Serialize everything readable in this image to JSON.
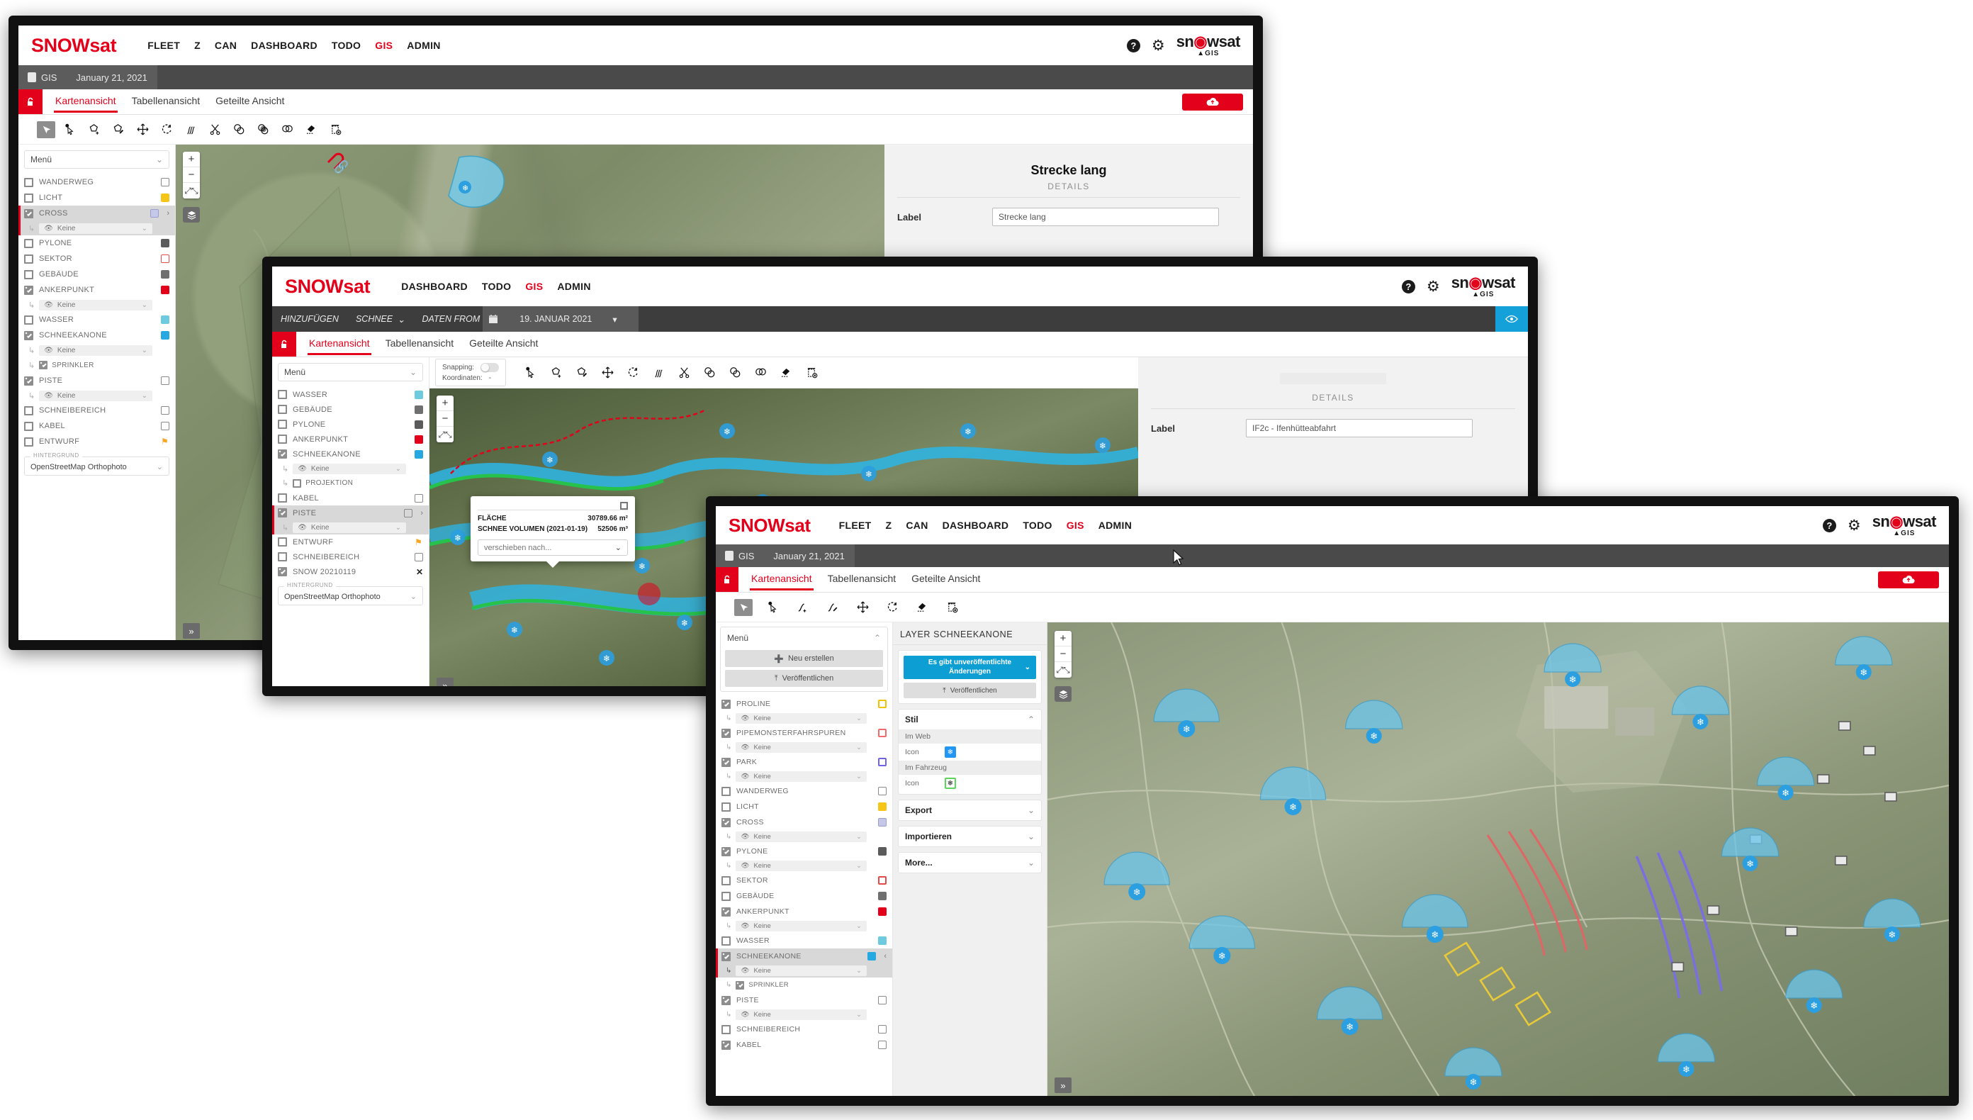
{
  "brand": "SNOWsat",
  "logo": {
    "line1_a": "sn",
    "line1_dot": "O",
    "line1_b": "wsat",
    "line2": "GIS"
  },
  "icons": {
    "help": "?",
    "gear": "gear-icon",
    "database": "database-icon",
    "cloud": "cloud-upload-icon",
    "lock": "lock-open-icon"
  },
  "window1": {
    "nav": [
      "FLEET",
      "Z",
      "CAN",
      "DASHBOARD",
      "TODO",
      "GIS",
      "ADMIN"
    ],
    "nav_active": "GIS",
    "context": {
      "app": "GIS",
      "date": "January 21, 2021"
    },
    "tabs": [
      "Kartenansicht",
      "Tabellenansicht",
      "Geteilte Ansicht"
    ],
    "tab_active": "Kartenansicht",
    "tools": [
      "select-pointer-icon",
      "info-select-icon",
      "draw-polygon-icon",
      "edit-polygon-icon",
      "move-icon",
      "rotate-icon",
      "split-line-icon",
      "scissors-icon",
      "union-icon",
      "intersect-icon",
      "difference-icon",
      "erase-icon",
      "delete-icon"
    ],
    "menu_label": "Menü",
    "layers": [
      {
        "name": "WANDERWEG",
        "checked": false,
        "selected": false,
        "swatch": "none",
        "sub": null
      },
      {
        "name": "LICHT",
        "checked": false,
        "selected": false,
        "swatch": "#f5c518",
        "sub": null
      },
      {
        "name": "CROSS",
        "checked": true,
        "selected": true,
        "swatch": "#c5c8e8",
        "chevron": "›",
        "sub": "Keine"
      },
      {
        "name": "PYLONE",
        "checked": false,
        "selected": false,
        "swatch": "#5b5b5b",
        "sub": null
      },
      {
        "name": "SEKTOR",
        "checked": false,
        "selected": false,
        "swatch": "#e34b4b",
        "sub": null
      },
      {
        "name": "GEBÄUDE",
        "checked": false,
        "selected": false,
        "swatch": "#6f6f6f",
        "sub": null
      },
      {
        "name": "ANKERPUNKT",
        "checked": true,
        "selected": false,
        "swatch": "#e3001b",
        "sub": "Keine"
      },
      {
        "name": "WASSER",
        "checked": false,
        "selected": false,
        "swatch": "#6ecadf",
        "sub": null
      },
      {
        "name": "SCHNEEKANONE",
        "checked": true,
        "selected": false,
        "swatch": "#26a9e0",
        "sub": "Keine"
      },
      {
        "name": "SPRINKLER",
        "checked": true,
        "selected": false,
        "swatch": "none",
        "indent": true,
        "sub": null
      },
      {
        "name": "PISTE",
        "checked": true,
        "selected": false,
        "swatch": "none",
        "sub": "Keine"
      },
      {
        "name": "SCHNEIBEREICH",
        "checked": false,
        "selected": false,
        "swatch": "none",
        "sub": null
      },
      {
        "name": "KABEL",
        "checked": false,
        "selected": false,
        "swatch": "none",
        "sub": null
      },
      {
        "name": "ENTWURF",
        "checked": false,
        "selected": false,
        "swatch": "#f5a623",
        "sub": null
      }
    ],
    "background": {
      "legend": "HINTERGRUND",
      "value": "OpenStreetMap Orthophoto"
    },
    "details": {
      "title": "Strecke lang",
      "subtitle": "DETAILS",
      "label_caption": "Label",
      "label_value": "Strecke lang"
    },
    "map": {
      "zoom_in": "+",
      "zoom_out": "−",
      "fit": "fit-icon",
      "layers": "layers-icon",
      "expand": "»"
    }
  },
  "window2": {
    "nav": [
      "DASHBOARD",
      "TODO",
      "GIS",
      "ADMIN"
    ],
    "nav_active": "GIS",
    "addbar": {
      "add": "HINZUFÜGEN",
      "type": "SCHNEE",
      "data_from": "DATEN FROM",
      "calendar": "calendar-icon",
      "date": "19. JANUAR 2021",
      "eye": "eye-icon"
    },
    "tabs": [
      "Kartenansicht",
      "Tabellenansicht",
      "Geteilte Ansicht"
    ],
    "tab_active": "Kartenansicht",
    "snapping": {
      "label": "Snapping:",
      "coords_label": "Koordinaten:",
      "coords_value": "-",
      "enabled": false
    },
    "tools": [
      "info-select-icon",
      "draw-polygon-icon",
      "edit-polygon-icon",
      "move-icon",
      "rotate-icon",
      "split-line-icon",
      "scissors-icon",
      "union-icon",
      "intersect-icon",
      "difference-icon",
      "erase-icon",
      "delete-icon"
    ],
    "menu_label": "Menü",
    "layers": [
      {
        "name": "WASSER",
        "checked": false,
        "selected": false,
        "swatch": "#6ecadf",
        "sub": null
      },
      {
        "name": "GEBÄUDE",
        "checked": false,
        "selected": false,
        "swatch": "#6f6f6f",
        "sub": null
      },
      {
        "name": "PYLONE",
        "checked": false,
        "selected": false,
        "swatch": "#5b5b5b",
        "sub": null
      },
      {
        "name": "ANKERPUNKT",
        "checked": false,
        "selected": false,
        "swatch": "#e3001b",
        "sub": null
      },
      {
        "name": "SCHNEEKANONE",
        "checked": true,
        "selected": false,
        "swatch": "#26a9e0",
        "sub": "Keine"
      },
      {
        "name": "PROJEKTION",
        "checked": false,
        "selected": false,
        "swatch": "none",
        "indent": true,
        "sub": null
      },
      {
        "name": "KABEL",
        "checked": false,
        "selected": false,
        "swatch": "none",
        "sub": null
      },
      {
        "name": "PISTE",
        "checked": true,
        "selected": true,
        "swatch": "none",
        "chevron": "›",
        "sub": "Keine"
      },
      {
        "name": "ENTWURF",
        "checked": false,
        "selected": false,
        "swatch": "#f5a623",
        "sub": null
      },
      {
        "name": "SCHNEIBEREICH",
        "checked": false,
        "selected": false,
        "swatch": "none",
        "sub": null
      },
      {
        "name": "SNOW 20210119",
        "checked": true,
        "selected": false,
        "swatch": "close",
        "sub": null
      }
    ],
    "background": {
      "legend": "HINTERGRUND",
      "value": "OpenStreetMap Orthophoto"
    },
    "popup": {
      "area_label": "FLÄCHE",
      "area_value": "30789.66 m²",
      "volume_label": "SCHNEE VOLUMEN (2021-01-19)",
      "volume_value": "52506 m³",
      "move_to": "verschieben nach..."
    },
    "details": {
      "subtitle": "DETAILS",
      "label_caption": "Label",
      "label_value": "IF2c - Ifenhütteabfahrt"
    },
    "map": {
      "zoom_in": "+",
      "zoom_out": "−",
      "fit": "fit-icon",
      "layers": "layers-icon",
      "expand": "»"
    }
  },
  "window3": {
    "nav": [
      "FLEET",
      "Z",
      "CAN",
      "DASHBOARD",
      "TODO",
      "GIS",
      "ADMIN"
    ],
    "nav_active": "GIS",
    "context": {
      "app": "GIS",
      "date": "January 21, 2021"
    },
    "tabs": [
      "Kartenansicht",
      "Tabellenansicht",
      "Geteilte Ansicht"
    ],
    "tab_active": "Kartenansicht",
    "tools": [
      "select-pointer-icon",
      "info-select-icon",
      "draw-line-icon",
      "edit-line-icon",
      "move-icon",
      "rotate-icon",
      "erase-icon",
      "delete-icon"
    ],
    "menu_label": "Menü",
    "menu_actions": {
      "new": "Neu erstellen",
      "publish": "Veröffentlichen"
    },
    "layers": [
      {
        "name": "PROLINE",
        "checked": true,
        "selected": false,
        "swatch": "#f2c200",
        "sub": "Keine"
      },
      {
        "name": "PIPEMONSTERFAHRSPUREN",
        "checked": true,
        "selected": false,
        "swatch": "#f26b6b",
        "sub": "Keine"
      },
      {
        "name": "PARK",
        "checked": true,
        "selected": false,
        "swatch": "#6f63e8",
        "sub": "Keine"
      },
      {
        "name": "WANDERWEG",
        "checked": false,
        "selected": false,
        "swatch": "none",
        "sub": null
      },
      {
        "name": "LICHT",
        "checked": false,
        "selected": false,
        "swatch": "#f5c518",
        "sub": null
      },
      {
        "name": "CROSS",
        "checked": true,
        "selected": false,
        "swatch": "#c5c8e8",
        "sub": "Keine"
      },
      {
        "name": "PYLONE",
        "checked": true,
        "selected": false,
        "swatch": "#5b5b5b",
        "sub": "Keine"
      },
      {
        "name": "SEKTOR",
        "checked": false,
        "selected": false,
        "swatch": "#e34b4b",
        "sub": null
      },
      {
        "name": "GEBÄUDE",
        "checked": false,
        "selected": false,
        "swatch": "#6f6f6f",
        "sub": null
      },
      {
        "name": "ANKERPUNKT",
        "checked": true,
        "selected": false,
        "swatch": "#e3001b",
        "sub": "Keine"
      },
      {
        "name": "WASSER",
        "checked": false,
        "selected": false,
        "swatch": "#6ecadf",
        "sub": null
      },
      {
        "name": "SCHNEEKANONE",
        "checked": true,
        "selected": true,
        "swatch": "#26a9e0",
        "chevron": "‹",
        "sub": "Keine"
      },
      {
        "name": "SPRINKLER",
        "checked": true,
        "selected": false,
        "swatch": "none",
        "indent": true,
        "sub": null
      },
      {
        "name": "PISTE",
        "checked": true,
        "selected": false,
        "swatch": "none",
        "sub": "Keine"
      },
      {
        "name": "SCHNEIBEREICH",
        "checked": false,
        "selected": false,
        "swatch": "none",
        "sub": null
      },
      {
        "name": "KABEL",
        "checked": true,
        "selected": false,
        "swatch": "none",
        "sub": null
      }
    ],
    "layer_panel": {
      "title": "LAYER SCHNEEKANONE",
      "unpublished_btn": "Es gibt unveröffentlichte Änderungen",
      "publish_btn": "Veröffentlichen",
      "sections": [
        {
          "title": "Stil",
          "open": true
        },
        {
          "title": "Export",
          "open": false
        },
        {
          "title": "Importieren",
          "open": false
        },
        {
          "title": "More...",
          "open": false
        }
      ],
      "style": {
        "web_header": "Im Web",
        "web_icon_label": "Icon",
        "web_icon": "snowflake-icon",
        "web_icon_color": "#2196f3",
        "vehicle_header": "Im Fahrzeug",
        "vehicle_icon_label": "Icon",
        "vehicle_icon": "snowflake-icon",
        "vehicle_icon_color": "#5cd65c"
      }
    },
    "map": {
      "zoom_in": "+",
      "zoom_out": "−",
      "fit": "fit-icon",
      "layers": "layers-icon",
      "expand": "»"
    }
  }
}
